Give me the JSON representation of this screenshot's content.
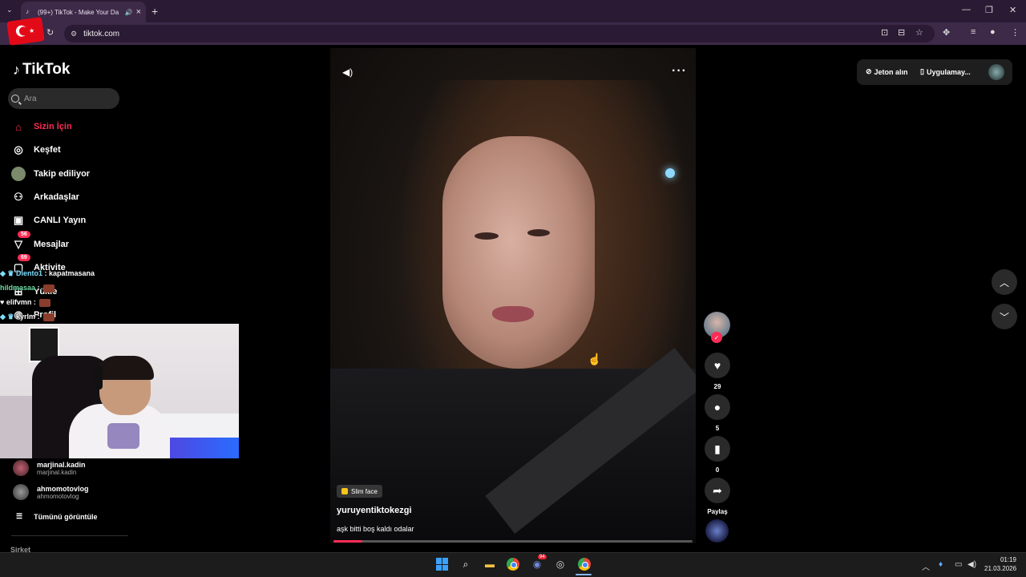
{
  "browser": {
    "tab_title": "(99+) TikTok - Make Your Da",
    "url": "tiktok.com"
  },
  "sidebar": {
    "logo": "TikTok",
    "search_placeholder": "Ara",
    "nav": [
      {
        "label": "Sizin İçin",
        "icon": "home-icon"
      },
      {
        "label": "Keşfet",
        "icon": "compass-icon"
      },
      {
        "label": "Takip ediliyor",
        "icon": "following-avatar-icon"
      },
      {
        "label": "Arkadaşlar",
        "icon": "friends-icon"
      },
      {
        "label": "CANLI Yayın",
        "icon": "live-icon"
      },
      {
        "label": "Mesajlar",
        "icon": "messages-icon",
        "badge": "56"
      },
      {
        "label": "Aktivite",
        "icon": "activity-icon",
        "badge": "69"
      },
      {
        "label": "Yükle",
        "icon": "upload-icon"
      },
      {
        "label": "Profil",
        "icon": "profile-icon"
      }
    ],
    "following": [
      {
        "name": "marjinal.kadin",
        "handle": "marjinal.kadin"
      },
      {
        "name": "ahmomotovlog",
        "handle": "ahmomotovlog"
      }
    ],
    "see_all": "Tümünü görüntüle",
    "footer": "Şirket"
  },
  "stream_chat": [
    {
      "user": "Diento1",
      "message": "kapatmasana"
    },
    {
      "user": "hildmasaa",
      "message": ""
    },
    {
      "user": "elifvmn",
      "message": ""
    },
    {
      "user": "kyrlm",
      "message": ""
    }
  ],
  "video": {
    "effect": "Slim face",
    "author": "yuruyentiktokezgi",
    "caption": "aşk bitti boş kaldı odalar",
    "progress": 0.08,
    "likes": "29",
    "comments": "5",
    "saves": "0",
    "share": "Paylaş"
  },
  "header": {
    "coins": "Jeton alın",
    "app": "Uygulamay..."
  },
  "taskbar": {
    "time": "01:19",
    "date": "21.03.2026",
    "discord_badge": "94"
  }
}
